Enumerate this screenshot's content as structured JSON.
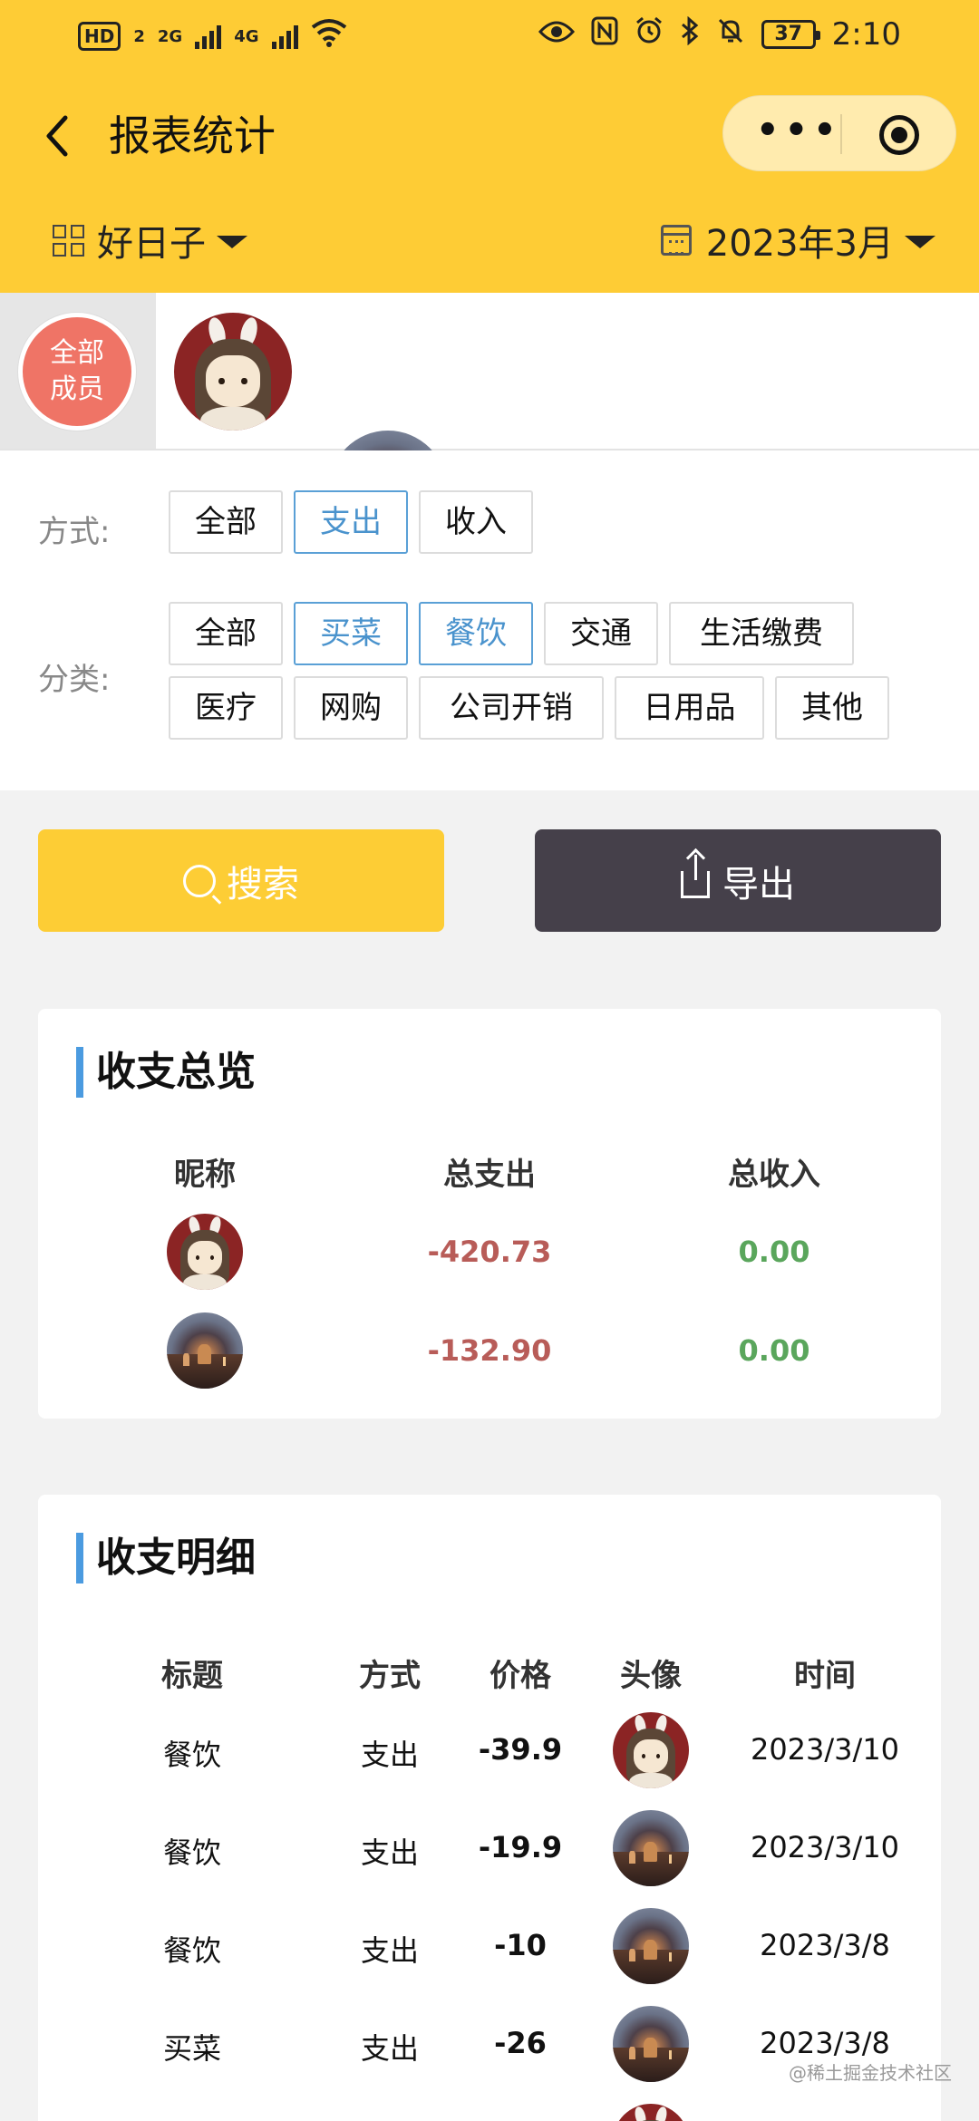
{
  "status_bar": {
    "left_label": "HD",
    "sim": "2",
    "net1": "2G",
    "net2": "4G",
    "battery": "37",
    "time": "2:10"
  },
  "nav": {
    "title": "报表统计"
  },
  "filter_bar": {
    "ledger": "好日子",
    "month": "2023年3月"
  },
  "members": {
    "all_label_line1": "全部",
    "all_label_line2": "成员"
  },
  "filters": {
    "method_label": "方式:",
    "methods": [
      "全部",
      "支出",
      "收入"
    ],
    "category_label": "分类:",
    "categories": [
      "全部",
      "买菜",
      "餐饮",
      "交通",
      "生活缴费",
      "医疗",
      "网购",
      "公司开销",
      "日用品",
      "其他"
    ]
  },
  "buttons": {
    "search": "搜索",
    "export": "导出"
  },
  "overview": {
    "title": "收支总览",
    "headers": [
      "昵称",
      "总支出",
      "总收入"
    ],
    "rows": [
      {
        "expense": "-420.73",
        "income": "0.00"
      },
      {
        "expense": "-132.90",
        "income": "0.00"
      }
    ]
  },
  "detail": {
    "title": "收支明细",
    "headers": [
      "标题",
      "方式",
      "价格",
      "头像",
      "时间"
    ],
    "rows": [
      {
        "title": "餐饮",
        "method": "支出",
        "price": "-39.9",
        "time": "2023/3/10"
      },
      {
        "title": "餐饮",
        "method": "支出",
        "price": "-19.9",
        "time": "2023/3/10"
      },
      {
        "title": "餐饮",
        "method": "支出",
        "price": "-10",
        "time": "2023/3/8"
      },
      {
        "title": "买菜",
        "method": "支出",
        "price": "-26",
        "time": "2023/3/8"
      }
    ]
  },
  "watermark": "@稀土掘金技术社区",
  "colors": {
    "brand_yellow": "#fecc35",
    "accent_blue": "#4b9be0",
    "expense_red": "#b85c58",
    "income_green": "#5aa65c",
    "export_dark": "#45404a"
  }
}
